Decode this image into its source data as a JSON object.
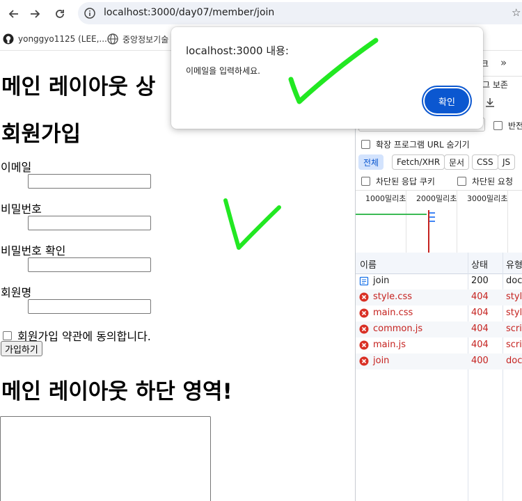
{
  "browser": {
    "url": "localhost:3000/day07/member/join",
    "bookmarks": [
      {
        "label": "yonggyo1125 (LEE,..."
      },
      {
        "label": "중앙정보기술"
      }
    ]
  },
  "page": {
    "header_heading": "메인 레이아웃 상",
    "join_heading": "회원가입",
    "fields": [
      {
        "label": "이메일",
        "value": ""
      },
      {
        "label": "비밀번호",
        "value": ""
      },
      {
        "label": "비밀번호 확인",
        "value": ""
      },
      {
        "label": "회원명",
        "value": ""
      }
    ],
    "agree_label": "회원가입 약관에 동의합니다.",
    "submit_label": "가입하기",
    "footer_heading": "메인 레이아웃 하단 영역!"
  },
  "dialog": {
    "title": "localhost:3000 내용:",
    "message": "이메일을 입력하세요.",
    "ok_label": "확인"
  },
  "devtools": {
    "tab_fragment": "크",
    "preserve_log_fragment": "그 보존",
    "invert_fragment": "반전",
    "hide_extension_urls": "확장 프로그램 URL 숨기기",
    "filters": [
      "전체",
      "Fetch/XHR",
      "문서",
      "CSS",
      "JS"
    ],
    "blocked_cookies": "차단된 응답 쿠키",
    "blocked_requests": "차단된 요청",
    "timeline_ticks": [
      "1000밀리초",
      "2000밀리초",
      "3000밀리초"
    ],
    "columns": {
      "name": "이름",
      "status": "상태",
      "type": "유형"
    },
    "requests": [
      {
        "name": "join",
        "status": "200",
        "type": "doc",
        "error": false
      },
      {
        "name": "style.css",
        "status": "404",
        "type": "style",
        "error": true
      },
      {
        "name": "main.css",
        "status": "404",
        "type": "style",
        "error": true
      },
      {
        "name": "common.js",
        "status": "404",
        "type": "scrip",
        "error": true
      },
      {
        "name": "main.js",
        "status": "404",
        "type": "scrip",
        "error": true
      },
      {
        "name": "join",
        "status": "400",
        "type": "doc",
        "error": true
      }
    ]
  },
  "colors": {
    "accent": "#0b57d0",
    "error": "#c5221f",
    "annotation": "#22e822"
  }
}
